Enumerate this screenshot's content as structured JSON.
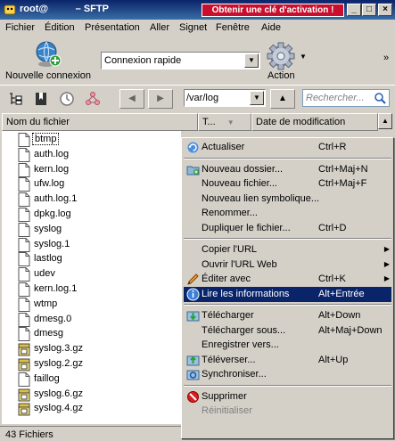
{
  "window": {
    "title": "root@",
    "title_suffix": "– SFTP",
    "activation_banner": "Obtenir une clé d'activation !",
    "buttons": {
      "minimize": "_",
      "maximize": "□",
      "close": "×"
    }
  },
  "menu": [
    "Fichier",
    "Édition",
    "Présentation",
    "Aller",
    "Signet",
    "Fenêtre",
    "Aide"
  ],
  "toolbar": {
    "new_connection_label": "Nouvelle connexion",
    "quick_connect_value": "Connexion rapide",
    "action_label": "Action",
    "more_chevron": "»"
  },
  "navbar": {
    "path": "/var/log",
    "search_placeholder": "Rechercher..."
  },
  "columns": {
    "name": "Nom du fichier",
    "type": "T...",
    "modified": "Date de modification"
  },
  "files": [
    {
      "name": "btmp",
      "icon": "file-icon"
    },
    {
      "name": "auth.log",
      "icon": "file-icon"
    },
    {
      "name": "kern.log",
      "icon": "file-icon"
    },
    {
      "name": "ufw.log",
      "icon": "file-icon"
    },
    {
      "name": "auth.log.1",
      "icon": "file-icon"
    },
    {
      "name": "dpkg.log",
      "icon": "file-icon"
    },
    {
      "name": "syslog",
      "icon": "file-icon"
    },
    {
      "name": "syslog.1",
      "icon": "file-icon"
    },
    {
      "name": "lastlog",
      "icon": "file-icon"
    },
    {
      "name": "udev",
      "icon": "file-icon"
    },
    {
      "name": "kern.log.1",
      "icon": "file-icon"
    },
    {
      "name": "wtmp",
      "icon": "file-icon"
    },
    {
      "name": "dmesg.0",
      "icon": "file-icon"
    },
    {
      "name": "dmesg",
      "icon": "file-icon"
    },
    {
      "name": "syslog.3.gz",
      "icon": "archive-icon"
    },
    {
      "name": "syslog.2.gz",
      "icon": "archive-icon"
    },
    {
      "name": "faillog",
      "icon": "file-icon"
    },
    {
      "name": "syslog.6.gz",
      "icon": "archive-icon"
    },
    {
      "name": "syslog.4.gz",
      "icon": "archive-icon"
    }
  ],
  "status": "43 Fichiers",
  "context_menu": [
    {
      "label": "Actualiser",
      "shortcut": "Ctrl+R",
      "icon": "refresh-icon"
    },
    {
      "sep": true
    },
    {
      "label": "Nouveau dossier...",
      "shortcut": "Ctrl+Maj+N",
      "icon": "new-folder-icon"
    },
    {
      "label": "Nouveau fichier...",
      "shortcut": "Ctrl+Maj+F"
    },
    {
      "label": "Nouveau lien symbolique..."
    },
    {
      "label": "Renommer..."
    },
    {
      "label": "Dupliquer le fichier...",
      "shortcut": "Ctrl+D"
    },
    {
      "sep": true
    },
    {
      "label": "Copier l'URL",
      "submenu": true
    },
    {
      "label": "Ouvrir l'URL Web",
      "submenu": true
    },
    {
      "label": "Éditer avec",
      "shortcut": "Ctrl+K",
      "submenu": true,
      "icon": "pencil-icon"
    },
    {
      "label": "Lire les informations",
      "shortcut": "Alt+Entrée",
      "icon": "info-icon",
      "highlighted": true
    },
    {
      "sep": true
    },
    {
      "label": "Télécharger",
      "shortcut": "Alt+Down",
      "icon": "download-icon"
    },
    {
      "label": "Télécharger sous...",
      "shortcut": "Alt+Maj+Down"
    },
    {
      "label": "Enregistrer vers..."
    },
    {
      "label": "Téléverser...",
      "shortcut": "Alt+Up",
      "icon": "upload-icon"
    },
    {
      "label": "Synchroniser...",
      "icon": "sync-icon"
    },
    {
      "sep": true
    },
    {
      "label": "Supprimer",
      "icon": "delete-icon"
    },
    {
      "label": "Réinitialiser",
      "disabled": true
    }
  ],
  "colors": {
    "title_bar": "#0a246a",
    "activation_bg": "#c8102e",
    "menu_highlight": "#0a246a",
    "face": "#d4d0c8"
  }
}
